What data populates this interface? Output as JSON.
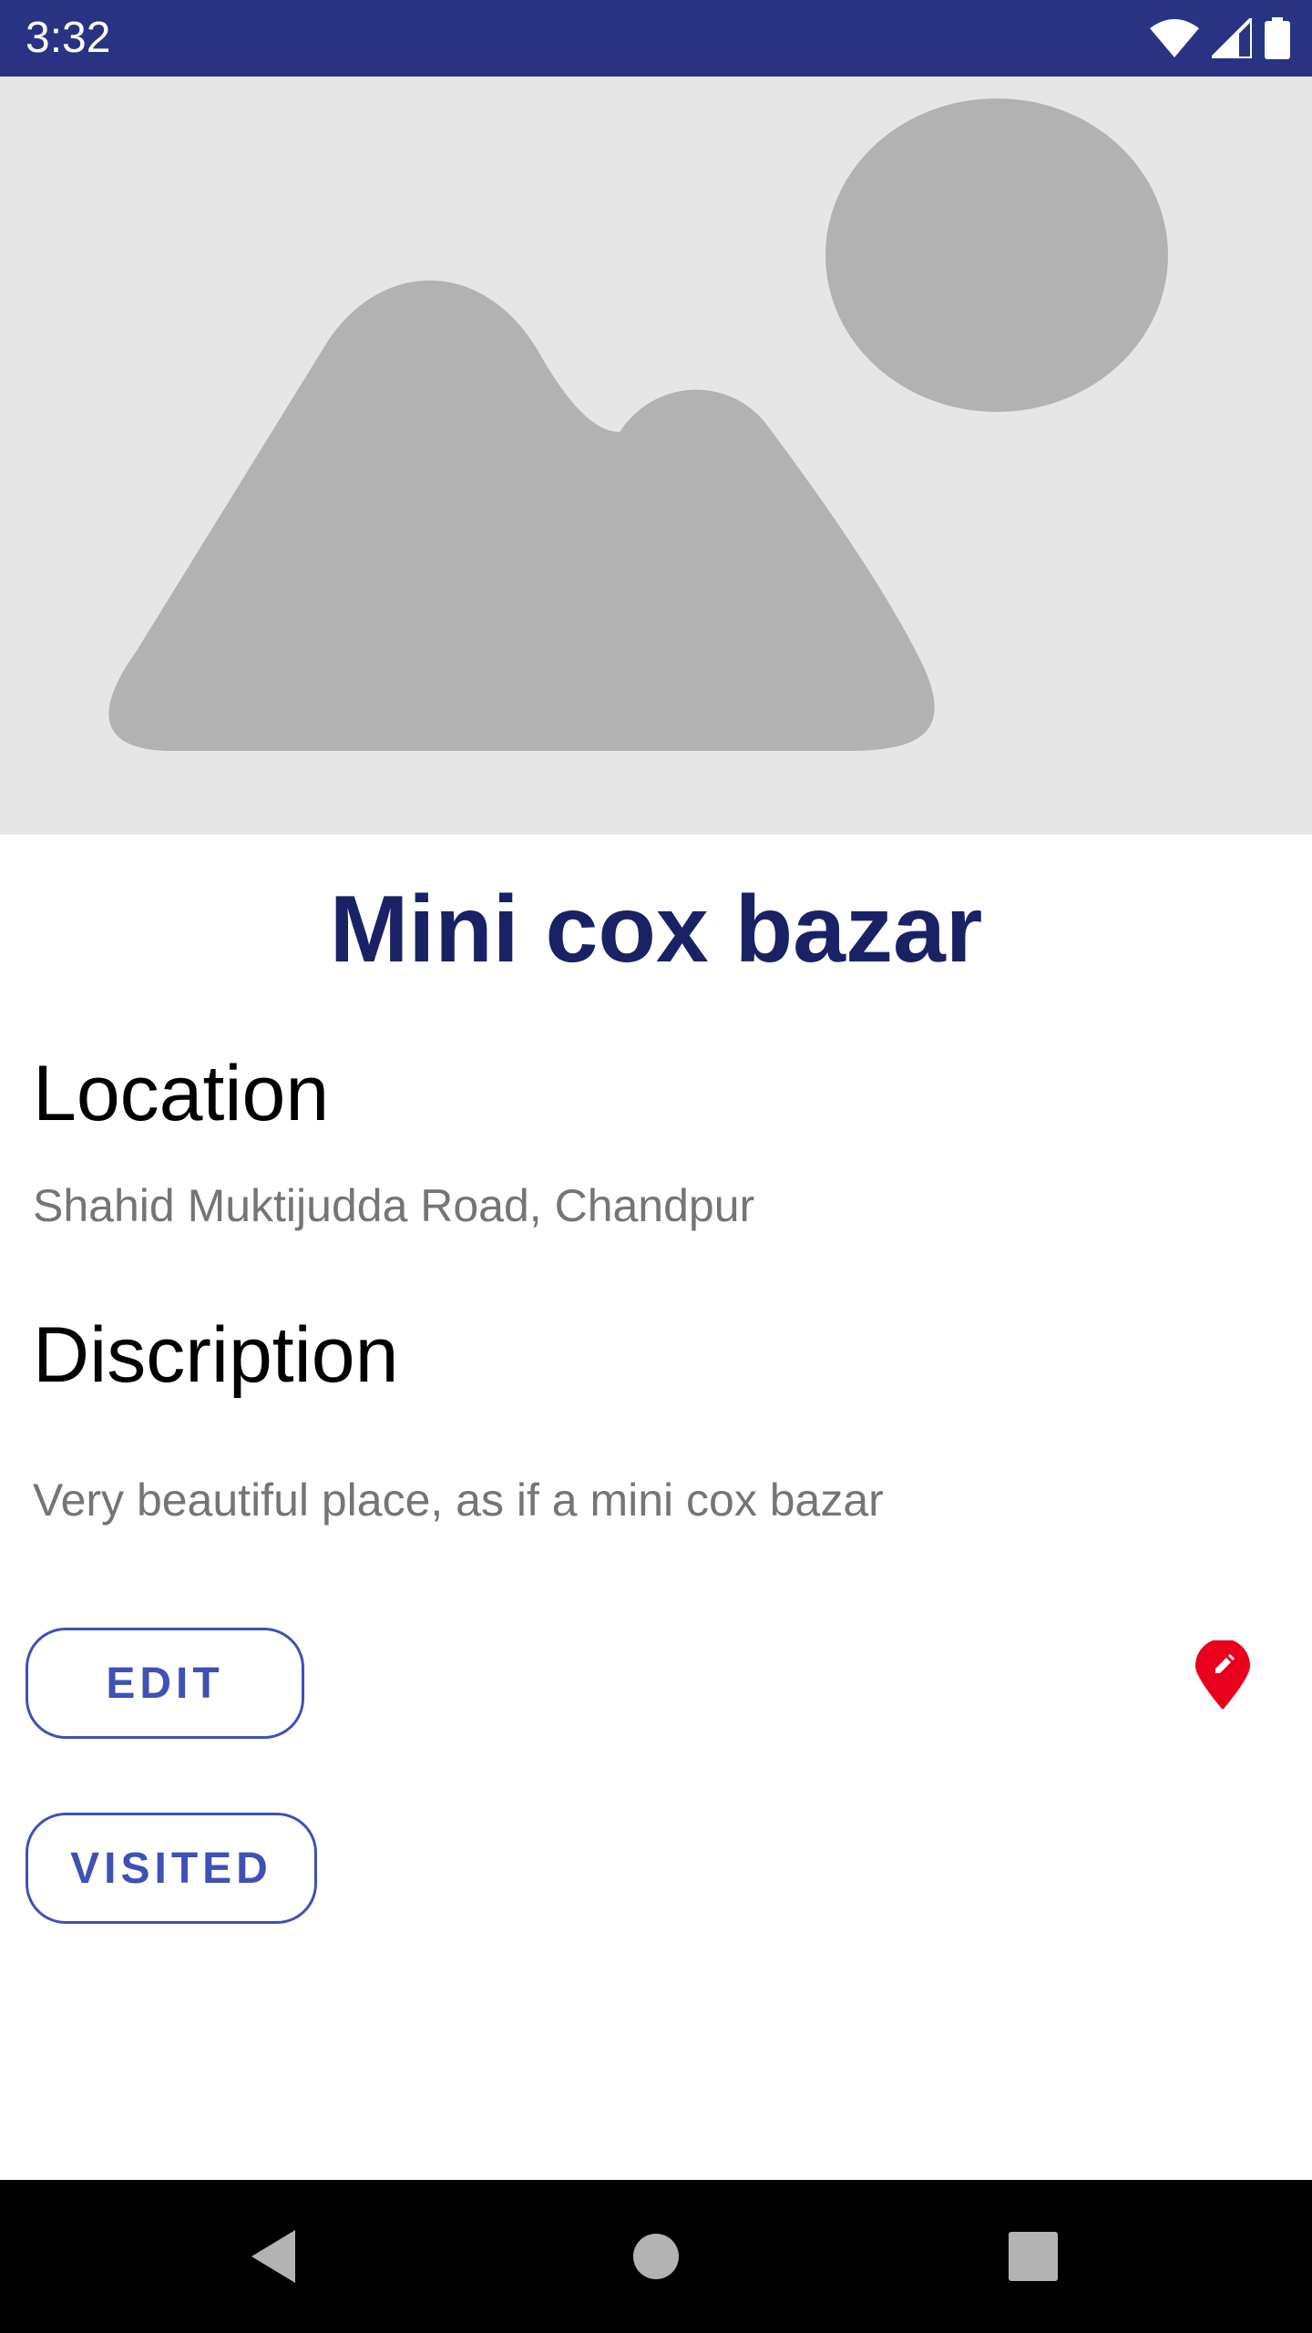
{
  "status_bar": {
    "time": "3:32",
    "icons": [
      "wifi-icon",
      "cell-signal-icon",
      "battery-icon"
    ],
    "background": "#283483"
  },
  "hero": {
    "image": "image-placeholder"
  },
  "place": {
    "title": "Mini cox bazar",
    "title_color": "#1a2266"
  },
  "location": {
    "heading": "Location",
    "value": "Shahid Muktijudda Road, Chandpur"
  },
  "description": {
    "heading": "Discription",
    "value": "Very beautiful place, as if a mini cox bazar"
  },
  "actions": {
    "edit_label": "EDIT",
    "visited_label": "VISITED",
    "accent": "#3f51b5",
    "map_pin_icon": "edit-location-icon",
    "map_pin_color": "#e8001c"
  },
  "nav_bar": {
    "buttons": [
      "back-icon",
      "home-icon",
      "recents-icon"
    ]
  }
}
